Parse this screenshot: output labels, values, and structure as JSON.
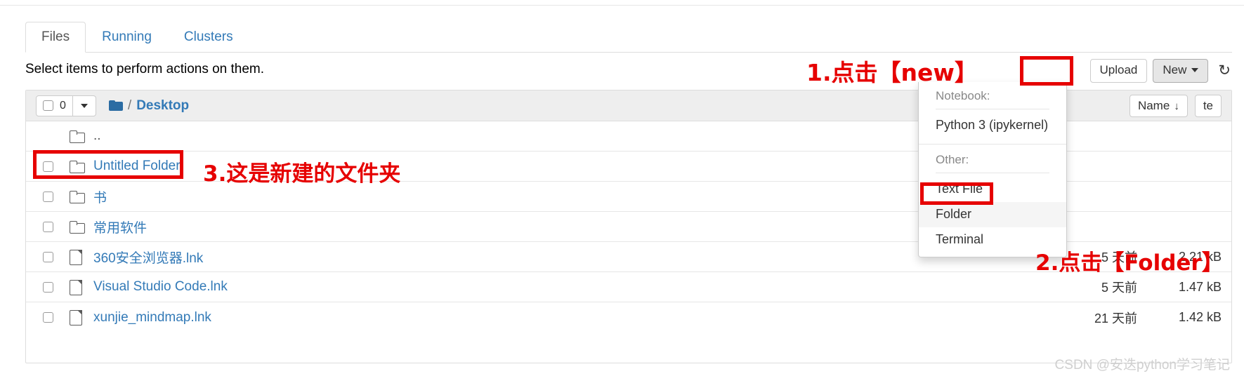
{
  "tabs": [
    {
      "label": "Files",
      "active": true
    },
    {
      "label": "Running",
      "active": false
    },
    {
      "label": "Clusters",
      "active": false
    }
  ],
  "notice": "Select items to perform actions on them.",
  "toolbar": {
    "upload_label": "Upload",
    "new_label": "New",
    "refresh_icon": "↻"
  },
  "listhead": {
    "selected_count": "0",
    "breadcrumb_sep": "/",
    "breadcrumb_path": "Desktop",
    "sort_name_label": "Name",
    "sort_name_arrow": "↓",
    "sort_date_label": "te"
  },
  "rows": [
    {
      "name": "..",
      "icon": "folder-icon",
      "date": "",
      "size": "",
      "checkbox": false,
      "parent": true
    },
    {
      "name": "Untitled Folder",
      "icon": "folder-icon",
      "date": "",
      "size": "",
      "checkbox": true,
      "parent": false
    },
    {
      "name": "书",
      "icon": "folder-icon",
      "date": "",
      "size": "",
      "checkbox": true,
      "parent": false
    },
    {
      "name": "常用软件",
      "icon": "folder-icon",
      "date": "",
      "size": "",
      "checkbox": true,
      "parent": false
    },
    {
      "name": "360安全浏览器.lnk",
      "icon": "file-icon",
      "date": "5 天前",
      "size": "2.21 kB",
      "checkbox": true,
      "parent": false
    },
    {
      "name": "Visual Studio Code.lnk",
      "icon": "file-icon",
      "date": "5 天前",
      "size": "1.47 kB",
      "checkbox": true,
      "parent": false
    },
    {
      "name": "xunjie_mindmap.lnk",
      "icon": "file-icon",
      "date": "21 天前",
      "size": "1.42 kB",
      "checkbox": true,
      "parent": false
    }
  ],
  "dropdown": {
    "notebook_header": "Notebook:",
    "kernel_item": "Python 3 (ipykernel)",
    "other_header": "Other:",
    "items": [
      {
        "label": "Text File",
        "highlighted": false
      },
      {
        "label": "Folder",
        "highlighted": true
      },
      {
        "label": "Terminal",
        "highlighted": false
      }
    ]
  },
  "annotations": [
    {
      "text": "1.点击【new】"
    },
    {
      "text": "2.点击【Folder】"
    },
    {
      "text": "3.这是新建的文件夹"
    }
  ],
  "watermark": "CSDN @安迭python学习笔记",
  "colors": {
    "link": "#337ab7",
    "annotation_red": "#e60000",
    "panel_head_bg": "#eeeeee"
  }
}
